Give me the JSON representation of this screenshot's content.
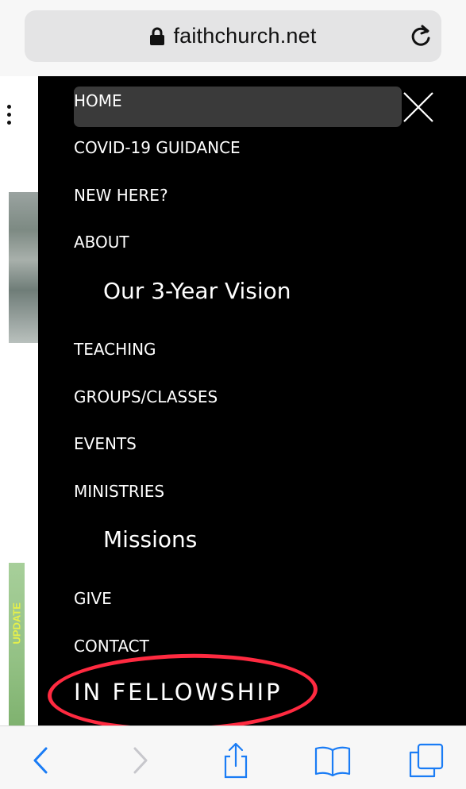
{
  "browser": {
    "url": "faithchurch.net"
  },
  "menu": {
    "items": [
      {
        "label": "HOME"
      },
      {
        "label": "COVID-19 GUIDANCE"
      },
      {
        "label": "NEW HERE?"
      },
      {
        "label": "ABOUT"
      },
      {
        "label": "Our 3-Year Vision"
      },
      {
        "label": "TEACHING"
      },
      {
        "label": "GROUPS/CLASSES"
      },
      {
        "label": "EVENTS"
      },
      {
        "label": "MINISTRIES"
      },
      {
        "label": "Missions"
      },
      {
        "label": "GIVE"
      },
      {
        "label": "CONTACT"
      },
      {
        "label": "IN FELLOWSHIP"
      }
    ],
    "highlight_color": "#ff2a40"
  },
  "page_behind": {
    "rotated_text": "UPDATE"
  },
  "colors": {
    "accent": "#1a7cf5",
    "menu_bg": "#000000"
  }
}
